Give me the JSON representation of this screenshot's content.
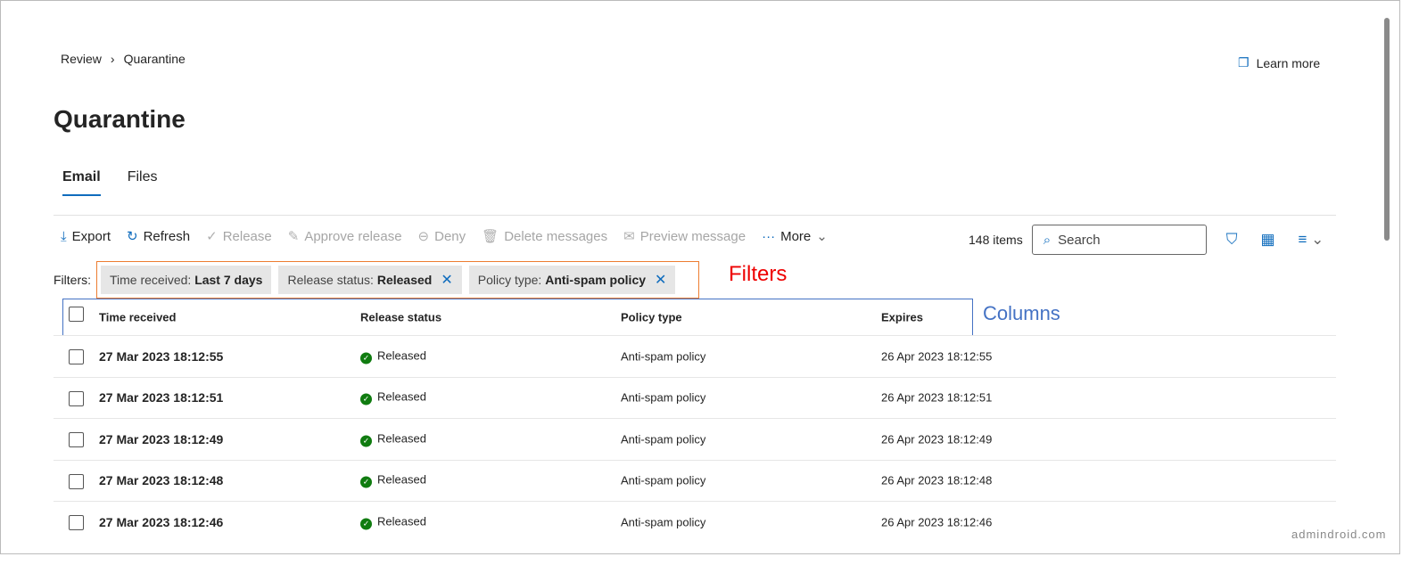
{
  "breadcrumb": [
    "Review",
    "Quarantine"
  ],
  "learn_more": "Learn more",
  "title": "Quarantine",
  "tabs": [
    {
      "label": "Email",
      "active": true
    },
    {
      "label": "Files",
      "active": false
    }
  ],
  "toolbar": {
    "export": "Export",
    "refresh": "Refresh",
    "release": "Release",
    "approve": "Approve release",
    "deny": "Deny",
    "delete": "Delete messages",
    "preview": "Preview message",
    "more": "More"
  },
  "item_count": "148 items",
  "search_placeholder": "Search",
  "filters": {
    "label": "Filters:",
    "chips": [
      {
        "key": "Time received:",
        "value": "Last 7 days"
      },
      {
        "key": "Release status:",
        "value": "Released"
      },
      {
        "key": "Policy type:",
        "value": "Anti-spam policy"
      }
    ]
  },
  "annotations": {
    "filters": "Filters",
    "columns": "Columns"
  },
  "columns": [
    "Time received",
    "Release status",
    "Policy type",
    "Expires"
  ],
  "rows": [
    {
      "time": "27 Mar 2023 18:12:55",
      "status": "Released",
      "policy": "Anti-spam policy",
      "expires": "26 Apr 2023 18:12:55"
    },
    {
      "time": "27 Mar 2023 18:12:51",
      "status": "Released",
      "policy": "Anti-spam policy",
      "expires": "26 Apr 2023 18:12:51"
    },
    {
      "time": "27 Mar 2023 18:12:49",
      "status": "Released",
      "policy": "Anti-spam policy",
      "expires": "26 Apr 2023 18:12:49"
    },
    {
      "time": "27 Mar 2023 18:12:48",
      "status": "Released",
      "policy": "Anti-spam policy",
      "expires": "26 Apr 2023 18:12:48"
    },
    {
      "time": "27 Mar 2023 18:12:46",
      "status": "Released",
      "policy": "Anti-spam policy",
      "expires": "26 Apr 2023 18:12:46"
    }
  ],
  "watermark": "admindroid.com"
}
